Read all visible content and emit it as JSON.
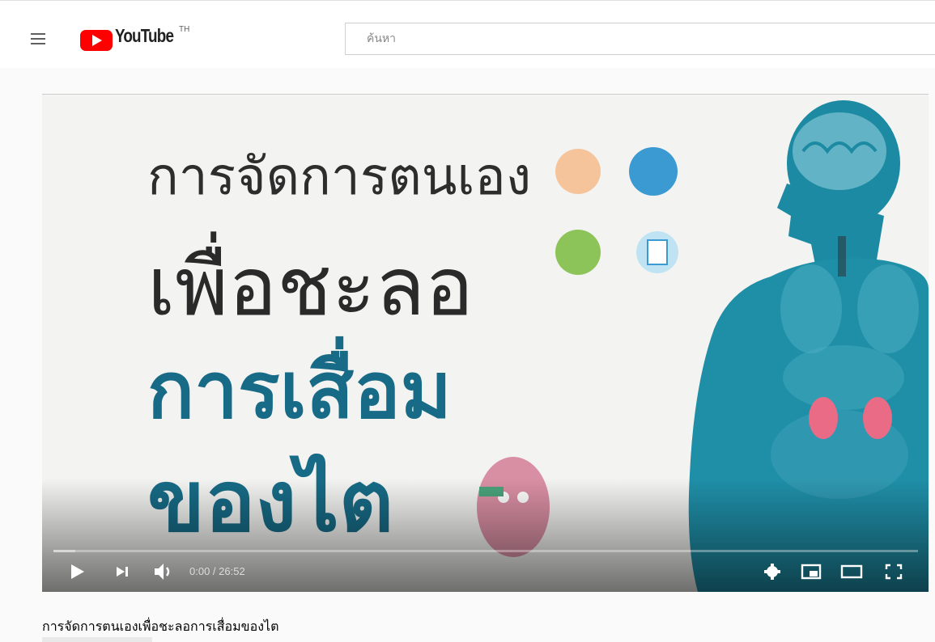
{
  "header": {
    "logo_text": "YouTube",
    "country_code": "TH",
    "search_placeholder": "ค้นหา"
  },
  "player": {
    "thumbnail_lines": [
      "การจัดการตนเอง",
      "เพื่อชะลอ",
      "การเสื่อม",
      "ของไต"
    ],
    "time_display": "0:00 / 26:52",
    "progress_fraction": 0.025,
    "controls": [
      "play-icon",
      "next-icon",
      "volume-icon",
      "settings-icon",
      "miniplayer-icon",
      "theater-icon",
      "fullscreen-icon"
    ]
  },
  "video": {
    "title": "การจัดการตนเองเพื่อชะลอการเสื่อมของไต"
  },
  "colors": {
    "brand_red": "#ff0000",
    "thumbnail_blue": "#176b86",
    "body_silhouette": "#1c8aa3"
  }
}
